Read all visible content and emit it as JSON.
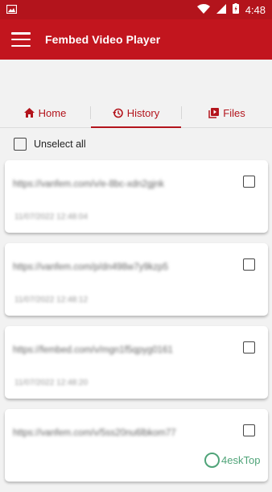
{
  "status_bar": {
    "time": "4:48"
  },
  "app_bar": {
    "title": "Fembed Video Player"
  },
  "tabs": [
    {
      "label": "Home",
      "icon": "home-icon",
      "active": false
    },
    {
      "label": "History",
      "icon": "history-icon",
      "active": true
    },
    {
      "label": "Files",
      "icon": "files-icon",
      "active": false
    }
  ],
  "unselect_all": {
    "label": "Unselect all",
    "checked": false
  },
  "history": [
    {
      "url": "https://vanfem.com/v/e-8bc-xdn2gjnk",
      "date": "11/07/2022 12:48:04",
      "checked": false
    },
    {
      "url": "https://vanfem.com/p/dn498w7y9kzp5",
      "date": "11/07/2022 12:48:12",
      "checked": false
    },
    {
      "url": "https://fembed.com/v/mgn1f5qpyg0161",
      "date": "11/07/2022 12:48:20",
      "checked": false
    },
    {
      "url": "https://vanfem.com/v/5ss20nu6lbkom77",
      "date": "",
      "checked": false
    }
  ],
  "watermark": {
    "text": "4eskTop"
  },
  "colors": {
    "primary": "#c2151e",
    "status_bar": "#b3141c",
    "background": "#f2f2f2"
  }
}
